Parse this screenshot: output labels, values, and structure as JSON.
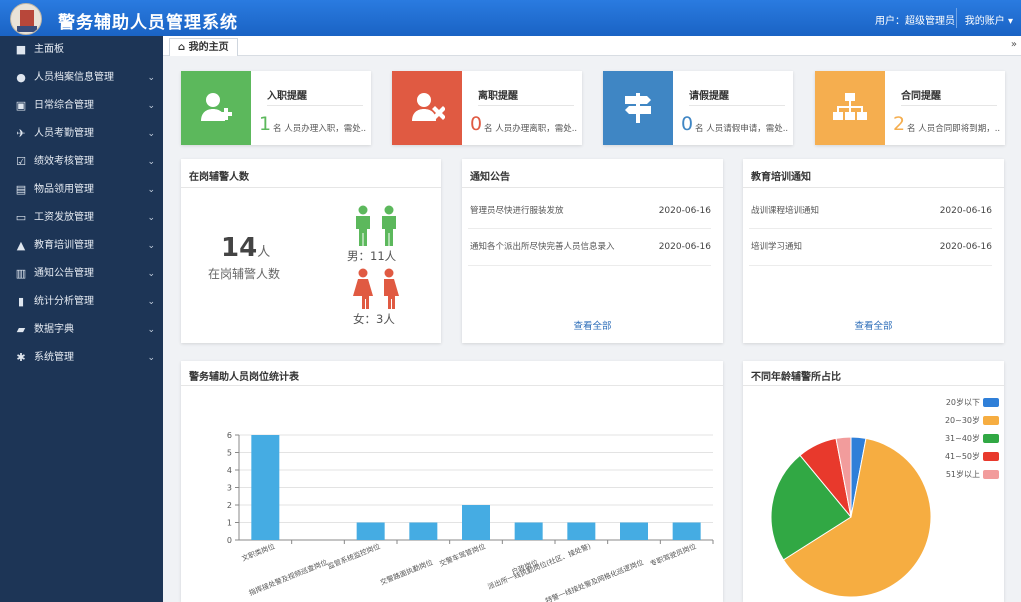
{
  "header": {
    "title": "警务辅助人员管理系统",
    "user_label": "用户：超级管理员",
    "account_label": "我的账户"
  },
  "sidebar": {
    "items": [
      {
        "label": "主面板",
        "icon": "dashboard-icon",
        "glyph": "■",
        "chev": ""
      },
      {
        "label": "人员档案信息管理",
        "icon": "users-icon",
        "glyph": "●",
        "chev": "⌄"
      },
      {
        "label": "日常综合管理",
        "icon": "id-card-icon",
        "glyph": "▣",
        "chev": "⌄"
      },
      {
        "label": "人员考勤管理",
        "icon": "plane-icon",
        "glyph": "✈",
        "chev": "⌄"
      },
      {
        "label": "绩效考核管理",
        "icon": "calendar-check-icon",
        "glyph": "☑",
        "chev": "⌄"
      },
      {
        "label": "物品领用管理",
        "icon": "briefcase-icon",
        "glyph": "▤",
        "chev": "⌄"
      },
      {
        "label": "工资发放管理",
        "icon": "credit-card-icon",
        "glyph": "▭",
        "chev": "⌄"
      },
      {
        "label": "教育培训管理",
        "icon": "graduation-cap-icon",
        "glyph": "▲",
        "chev": "⌄"
      },
      {
        "label": "通知公告管理",
        "icon": "newspaper-icon",
        "glyph": "▥",
        "chev": "⌄"
      },
      {
        "label": "统计分析管理",
        "icon": "bar-chart-icon",
        "glyph": "▮",
        "chev": "⌄"
      },
      {
        "label": "数据字典",
        "icon": "book-icon",
        "glyph": "▰",
        "chev": "⌄"
      },
      {
        "label": "系统管理",
        "icon": "gear-icon",
        "glyph": "✱",
        "chev": "⌄"
      }
    ]
  },
  "tabs": {
    "home_label": "我的主页",
    "expand_glyph": "»"
  },
  "reminders": [
    {
      "title": "入职提醒",
      "count": "1",
      "desc": "名 人员办理入职，需处...",
      "color": "#5cb85c",
      "icon": "add-user-icon"
    },
    {
      "title": "离职提醒",
      "count": "0",
      "desc": "名 人员办理离职，需处...",
      "color": "#e05a42",
      "icon": "remove-user-icon"
    },
    {
      "title": "请假提醒",
      "count": "0",
      "desc": "名 人员请假申请，需处...",
      "color": "#3f86c4",
      "icon": "signpost-icon"
    },
    {
      "title": "合同提醒",
      "count": "2",
      "desc": "名 人员合同即将到期，...",
      "color": "#f5ae4f",
      "icon": "sitemap-icon"
    }
  ],
  "staff": {
    "title": "在岗辅警人数",
    "count": "14",
    "unit": "人",
    "caption": "在岗辅警人数",
    "male_label": "男：11人",
    "female_label": "女：3人",
    "male_color": "#5cb85c",
    "female_color": "#e05a42"
  },
  "notices": {
    "title": "通知公告",
    "items": [
      {
        "text": "管理员尽快进行服装发放",
        "date": "2020-06-16"
      },
      {
        "text": "通知各个派出所尽快完善人员信息录入",
        "date": "2020-06-16"
      }
    ],
    "view_all": "查看全部"
  },
  "training": {
    "title": "教育培训通知",
    "items": [
      {
        "text": "战训课程培训通知",
        "date": "2020-06-16"
      },
      {
        "text": "培训学习通知",
        "date": "2020-06-16"
      }
    ],
    "view_all": "查看全部"
  },
  "chart_data": [
    {
      "type": "bar",
      "title": "警务辅助人员岗位统计表",
      "categories": [
        "文职类岗位",
        "指挥接处警及视频巡查岗位",
        "监管系统监控岗位",
        "交警路面执勤岗位",
        "交警车驾管岗位",
        "户政岗位",
        "派出所一线执勤岗位(社区、接处警)",
        "特警一线接处警及网格化巡逻岗位",
        "专职驾驶员岗位"
      ],
      "values": [
        6,
        0,
        1,
        1,
        2,
        1,
        1,
        1,
        1
      ],
      "ylim": [
        0,
        6
      ],
      "yticks": [
        0,
        1,
        2,
        3,
        4,
        5,
        6
      ],
      "color": "#45ace3",
      "grid": true
    },
    {
      "type": "pie",
      "title": "不同年龄辅警所占比",
      "legend_position": "top-right",
      "series": [
        {
          "name": "20岁以下",
          "value": 3,
          "color": "#2f7fd8"
        },
        {
          "name": "20~30岁",
          "value": 63,
          "color": "#f6ad41"
        },
        {
          "name": "31~40岁",
          "value": 23,
          "color": "#31a844"
        },
        {
          "name": "41~50岁",
          "value": 8,
          "color": "#e8392c"
        },
        {
          "name": "51岁以上",
          "value": 3,
          "color": "#f29c9c"
        }
      ]
    }
  ]
}
